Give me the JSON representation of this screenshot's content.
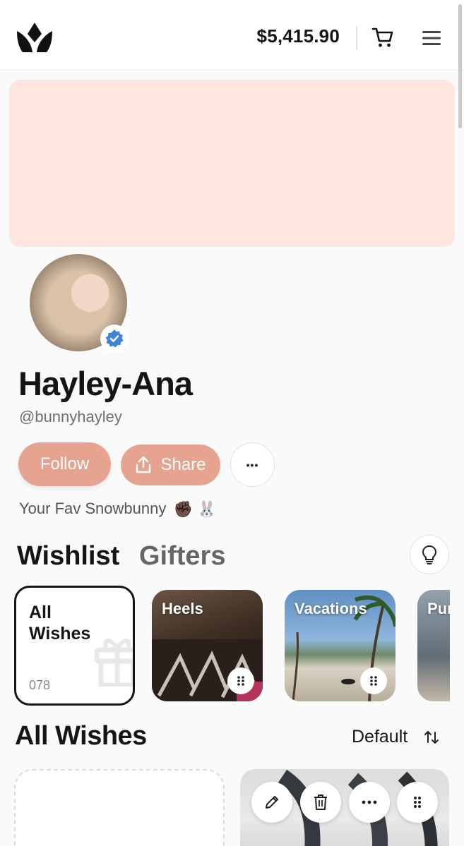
{
  "header": {
    "balance": "$5,415.90",
    "logo_icon": "crown-logo-icon",
    "cart_icon": "cart-icon",
    "menu_icon": "hamburger-menu-icon"
  },
  "profile": {
    "name": "Hayley-Ana",
    "handle": "@bunnyhayley",
    "bio": "Your Fav Snowbunny",
    "bio_emojis": "✊🏿 🐰",
    "verified": true,
    "cover_color": "#fce6de"
  },
  "actions": {
    "follow_label": "Follow",
    "share_label": "Share",
    "more_label": "•••",
    "accent_color": "#e6a390"
  },
  "tabs": {
    "wishlist": "Wishlist",
    "gifters": "Gifters"
  },
  "collections": [
    {
      "label": "All Wishes",
      "count": "078"
    },
    {
      "label": "Heels"
    },
    {
      "label": "Vacations"
    },
    {
      "label": "Pur"
    }
  ],
  "section": {
    "title": "All Wishes",
    "sort_label": "Default"
  }
}
